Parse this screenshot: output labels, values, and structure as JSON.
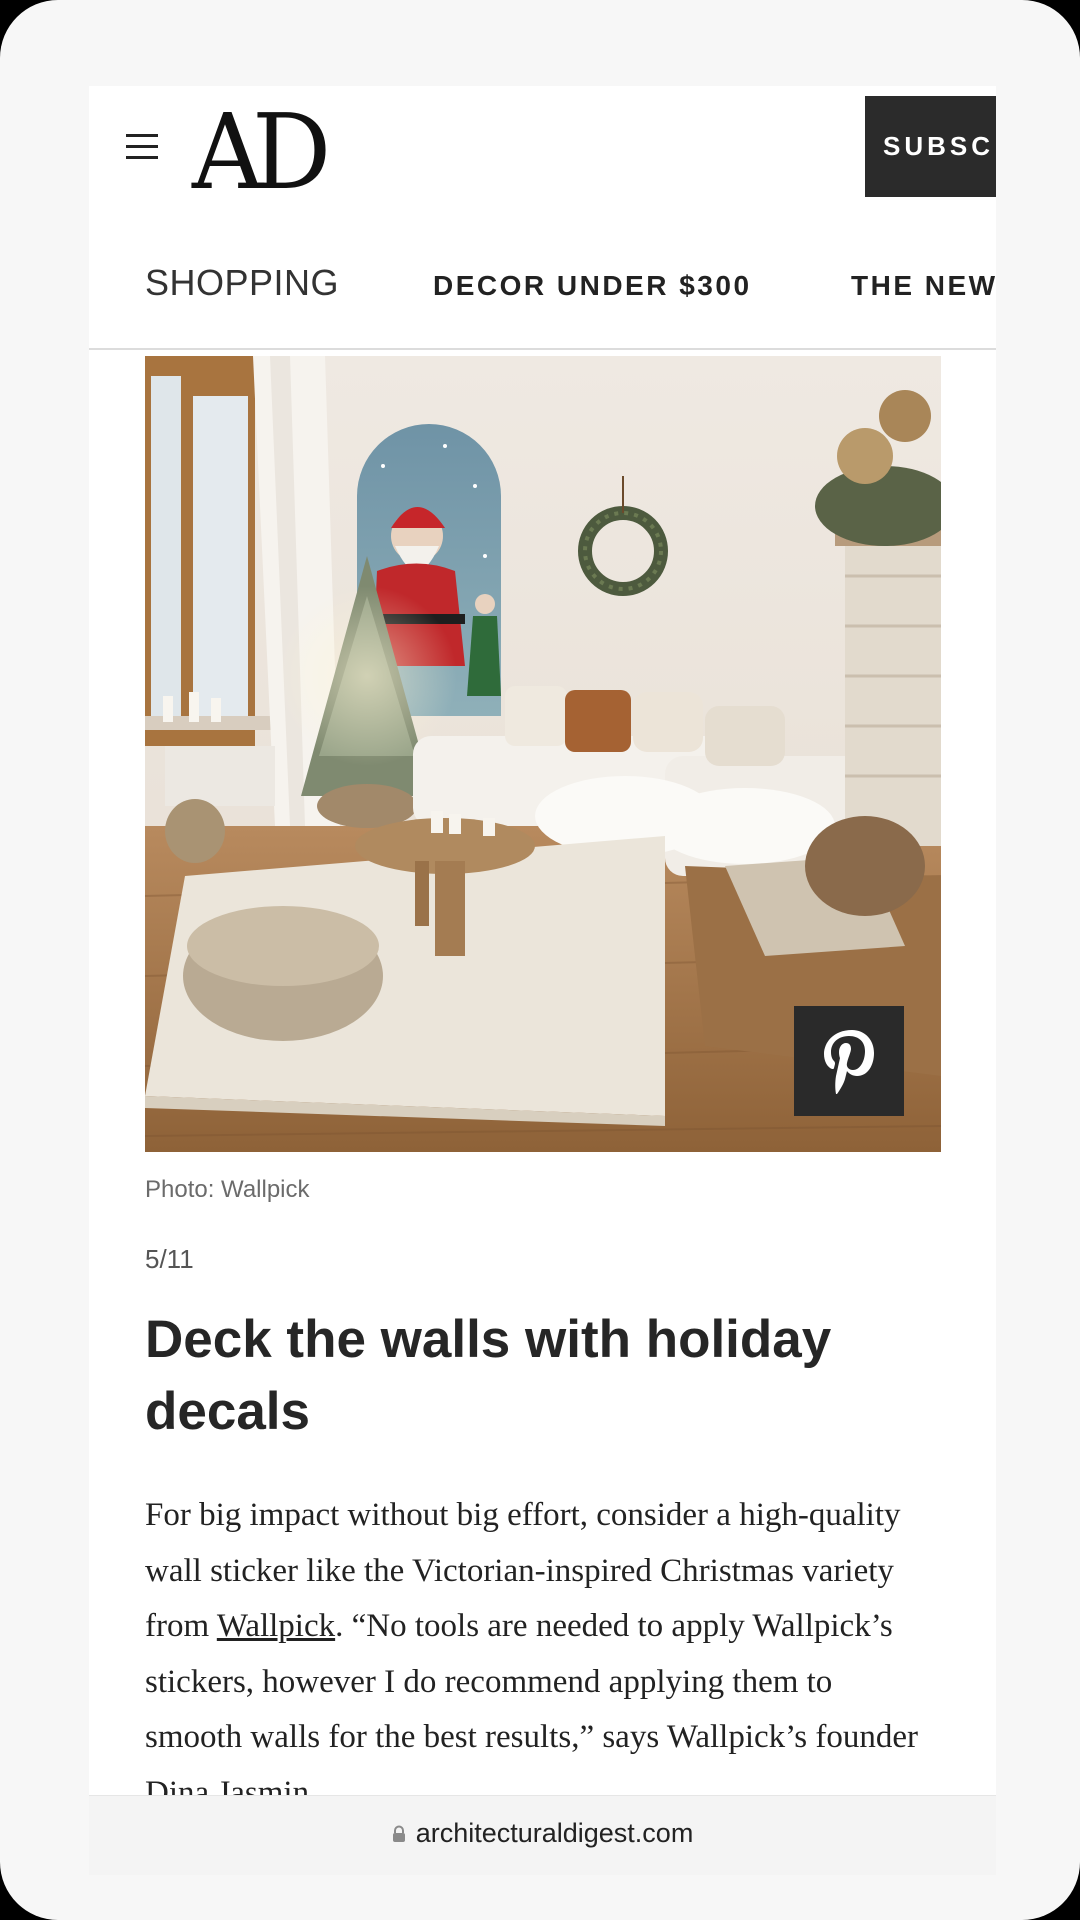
{
  "header": {
    "logo": "AD",
    "subscribe_label": "SUBSC"
  },
  "nav": {
    "items": [
      {
        "label": "SHOPPING"
      },
      {
        "label": "DECOR UNDER $300"
      },
      {
        "label": "THE NEW"
      }
    ]
  },
  "article": {
    "image_icon": "living-room-photo",
    "pin_icon": "pinterest-icon",
    "caption": "Photo: Wallpick",
    "counter": "5/11",
    "headline": "Deck the walls with holiday decals",
    "body_before_link": "For big impact without big effort, consider a high-quality wall sticker like the Victorian-inspired Christmas variety from ",
    "body_link": "Wallpick",
    "body_after_link": ". “No tools are needed to apply Wallpick’s stickers, however I do recommend applying them to smooth walls for the best results,” says Wallpick’s founder Dina Jasmin"
  },
  "urlbar": {
    "url": "architecturaldigest.com",
    "lock_icon": "lock-icon"
  }
}
